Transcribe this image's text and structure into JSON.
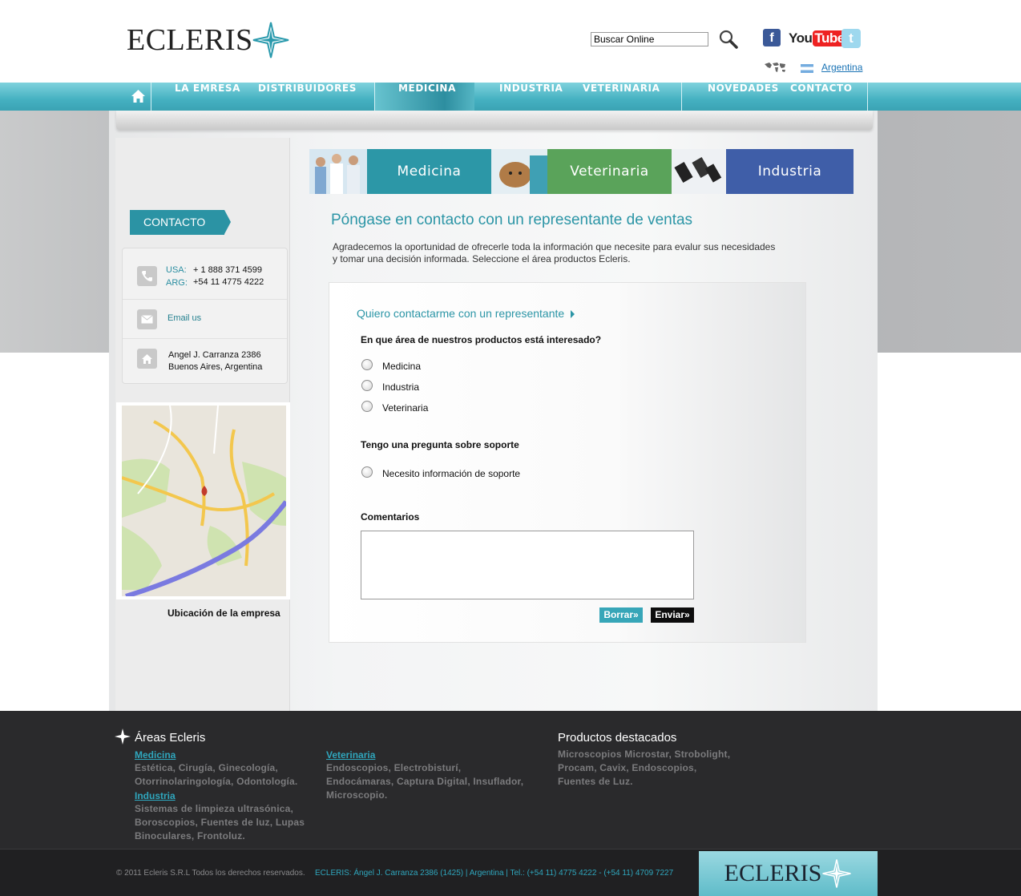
{
  "header": {
    "logo": "ECLERIS",
    "search_value": "Buscar Online",
    "social": [
      "facebook-icon",
      "youtube-icon",
      "twitter-icon"
    ],
    "youtube_you": "You",
    "youtube_tube": "Tube",
    "facebook_glyph": "f",
    "twitter_glyph": "t",
    "country": "Argentina"
  },
  "nav": {
    "items": [
      "LA EMRESA",
      "DISTRIBUIDORES",
      "MEDICINA",
      "INDUSTRIA",
      "VETERINARIA",
      "NOVEDADES",
      "CONTACTO"
    ],
    "active": "MEDICINA"
  },
  "sidebar": {
    "tab": "CONTACTO",
    "usa_label": "USA:",
    "usa_phone": "+ 1 888 371 4599",
    "arg_label": "ARG:",
    "arg_phone": "+54 11 4775 4222",
    "email": "Email us",
    "address_line1": "Angel J. Carranza 2386",
    "address_line2": "Buenos Aires, Argentina",
    "map_caption": "Ubicación de la empresa"
  },
  "banner": {
    "items": [
      "Medicina",
      "Veterinaria",
      "Industria"
    ]
  },
  "main": {
    "title": "Póngase en contacto con un representante de ventas",
    "intro_line1": "Agradecemos la oportunidad de ofrecerle toda la información que necesite para evalur sus necesidades",
    "intro_line2": "y tomar una decisión informada. Seleccione el área productos Ecleris."
  },
  "form": {
    "heading": "Quiero contactarme con un representante",
    "q1": "En que área de nuestros productos está interesado?",
    "options": [
      "Medicina",
      "Industria",
      "Veterinaria"
    ],
    "q2": "Tengo una pregunta sobre soporte",
    "support_option": "Necesito información de soporte",
    "comments_label": "Comentarios",
    "clear_button": "Borrar»",
    "send_button": "Enviar»"
  },
  "footer": {
    "areas_title": "Áreas Ecleris",
    "medicina_link": "Medicina",
    "medicina_text": [
      "Estética, Cirugía, Ginecología,",
      "Otorrinolaringología, Odontología."
    ],
    "industria_link": "Industria",
    "industria_text": [
      "Sistemas de limpieza ultrasónica,",
      "Boroscopios, Fuentes de luz, Lupas",
      "Binoculares, Frontoluz."
    ],
    "veterinaria_link": "Veterinaria",
    "veterinaria_text": [
      "Endoscopios, Electrobisturí,",
      "Endocámaras, Captura Digital, Insuflador,",
      "Microscopio."
    ],
    "productos_title": "Productos destacados",
    "productos_text": [
      "Microscopios Microstar, Strobolight,",
      "Procam, Cavix, Endoscopios,",
      "Fuentes de Luz."
    ],
    "copyright": "© 2011 Ecleris S.R.L Todos los derechos reservados.",
    "address": "ECLERIS: Ángel J. Carranza 2386 (1425) | Argentina | Tel.: (+54 11) 4775 4222 - (+54 11) 4709 7227",
    "logo": "ECLERIS"
  },
  "colors": {
    "accent": "#2b95a6",
    "nav": "#45b1c1",
    "medicina_banner": "#2c97a7",
    "veterinaria_banner": "#5aa35a",
    "industria_banner": "#3f5ea8",
    "footer_bg": "#2a2a2c"
  }
}
